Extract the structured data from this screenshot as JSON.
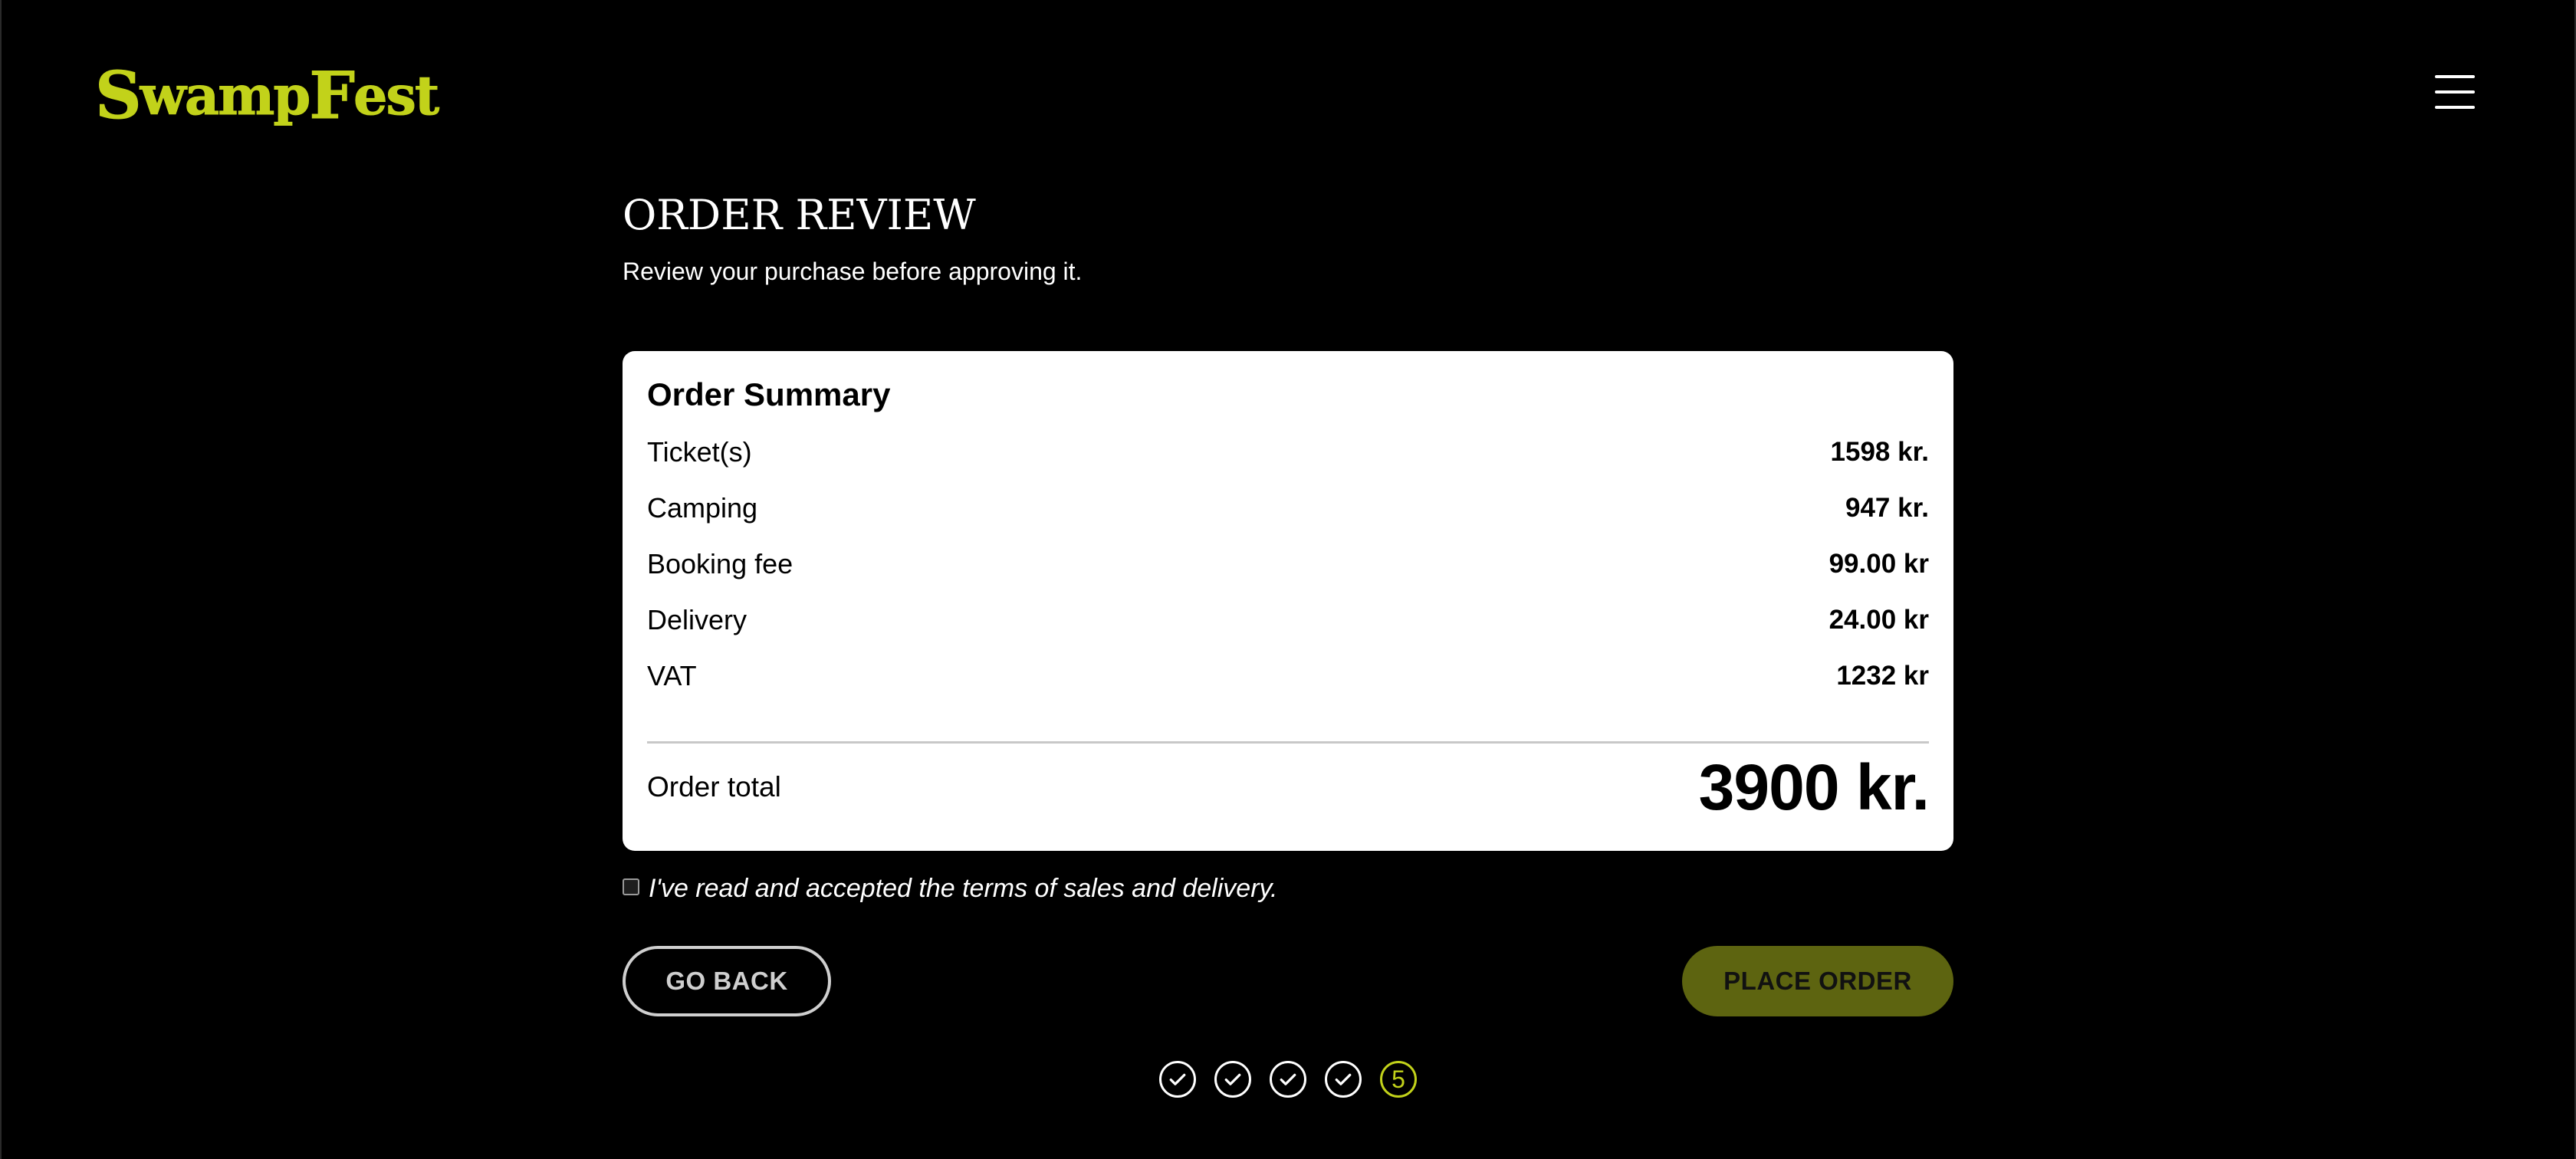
{
  "header": {
    "logo_text_1": "S",
    "logo_text_2": "wamp",
    "logo_text_3": "F",
    "logo_text_4": "est",
    "logo_color": "#c2d21a",
    "menu_icon": "hamburger-menu-icon"
  },
  "main": {
    "title": "ORDER REVIEW",
    "subtitle": "Review your purchase before approving it."
  },
  "summary": {
    "title": "Order Summary",
    "items": [
      {
        "label": "Ticket(s)",
        "value": "1598 kr."
      },
      {
        "label": "Camping",
        "value": "947 kr."
      },
      {
        "label": "Booking fee",
        "value": "99.00 kr"
      },
      {
        "label": "Delivery",
        "value": "24.00 kr"
      },
      {
        "label": "VAT",
        "value": "1232 kr"
      }
    ],
    "total_label": "Order total",
    "total_value": "3900 kr."
  },
  "terms": {
    "label": "I've read and accepted the terms of sales and delivery.",
    "checked": false
  },
  "actions": {
    "back_label": "GO BACK",
    "order_label": "PLACE ORDER",
    "order_color": "#5d6410"
  },
  "steps": {
    "completed_icon": "checkmark-circle-icon",
    "current_label": "5",
    "current_color": "#c2d21a"
  }
}
